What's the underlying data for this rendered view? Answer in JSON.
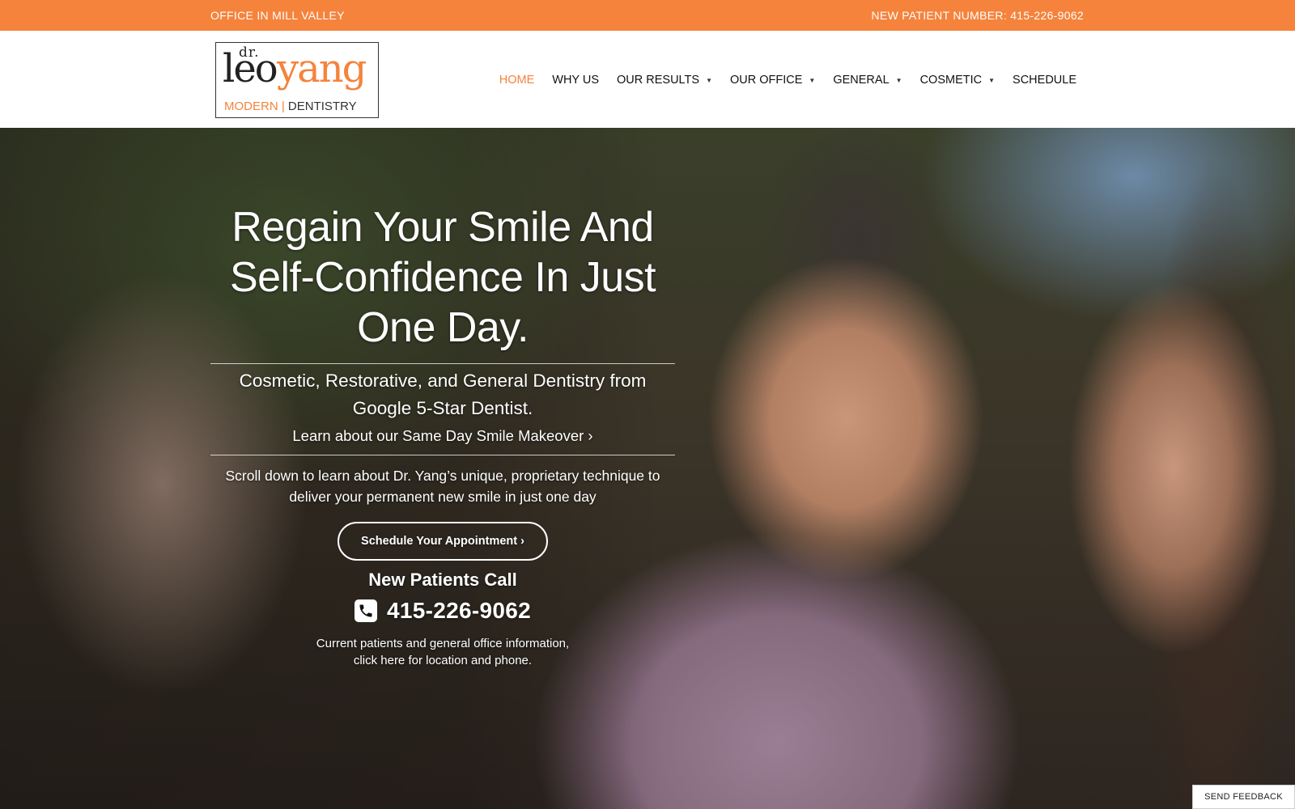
{
  "topbar": {
    "office": "OFFICE IN MILL VALLEY",
    "phone": "NEW PATIENT NUMBER: 415-226-9062",
    "background": "#f5833c"
  },
  "logo": {
    "dr": "dr.",
    "leo": "leo",
    "yang": "yang",
    "modern": "MODERN",
    "separator": "|",
    "dentistry": "DENTISTRY",
    "accent": "#f5833c"
  },
  "nav": {
    "items": [
      {
        "label": "HOME",
        "active": true,
        "dropdown": false
      },
      {
        "label": "WHY US",
        "active": false,
        "dropdown": false
      },
      {
        "label": "OUR RESULTS",
        "active": false,
        "dropdown": true
      },
      {
        "label": "OUR OFFICE",
        "active": false,
        "dropdown": true
      },
      {
        "label": "GENERAL",
        "active": false,
        "dropdown": true
      },
      {
        "label": "COSMETIC",
        "active": false,
        "dropdown": true
      },
      {
        "label": "SCHEDULE",
        "active": false,
        "dropdown": false
      }
    ],
    "caret": "▼"
  },
  "hero": {
    "headline_line1": "Regain Your Smile And",
    "headline_line2": "Self-Confidence In Just",
    "headline_line3": "One Day.",
    "subhead_line1": "Cosmetic, Restorative, and General Dentistry from",
    "subhead_line2": "Google 5-Star Dentist.",
    "learn_link": "Learn about our Same Day Smile Makeover ›",
    "scroll_line1": "Scroll down to learn about Dr. Yang’s unique, proprietary technique to",
    "scroll_line2": "deliver your permanent new smile in just one day",
    "cta": "Schedule Your Appointment ›",
    "new_patients": "New Patients Call",
    "phone_icon": "phone-icon",
    "phone": "415-226-9062",
    "current_line1": "Current patients and general office information,",
    "current_line2": "click here for location and phone."
  },
  "feedback": {
    "label": "SEND FEEDBACK"
  }
}
